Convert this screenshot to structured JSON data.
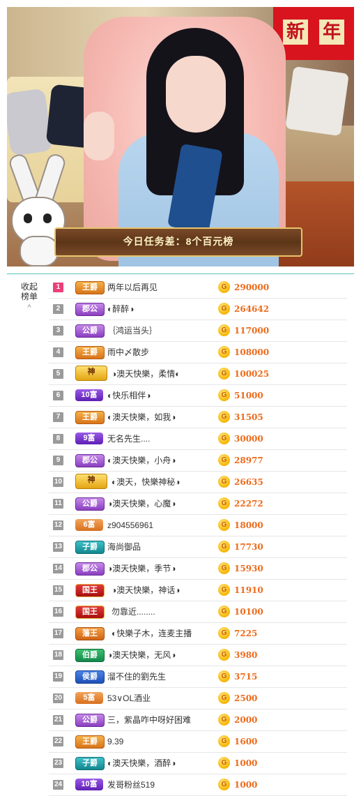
{
  "stream": {
    "banner_text": "今日任务差：8个百元榜",
    "decor_chars": [
      "新",
      "年"
    ]
  },
  "sidebar": {
    "collapse_label": "收起\n榜单",
    "collapse_line1": "收起",
    "collapse_line2": "榜单"
  },
  "leaderboard": [
    {
      "rank": "1",
      "badge": "王爵",
      "badge_type": "b-wang",
      "name": "两年以后再见",
      "score": "290000"
    },
    {
      "rank": "2",
      "badge": "郡公",
      "badge_type": "b-dugong",
      "name": "◐醉醉◑",
      "score": "264642"
    },
    {
      "rank": "3",
      "badge": "公爵",
      "badge_type": "b-gong",
      "name": "｛鸿运当头｝",
      "score": "117000"
    },
    {
      "rank": "4",
      "badge": "王爵",
      "badge_type": "b-wang",
      "name": "雨中〆散步",
      "score": "108000"
    },
    {
      "rank": "5",
      "badge": "神",
      "badge_type": "b-shen",
      "name": "◑澳天快樂，柔情◐",
      "score": "100025"
    },
    {
      "rank": "6",
      "badge": "10富",
      "badge_type": "b-fu",
      "name": "◐快乐相伴◑",
      "score": "51000"
    },
    {
      "rank": "7",
      "badge": "王爵",
      "badge_type": "b-wang",
      "name": "◐澳天快樂，如我◑",
      "score": "31505"
    },
    {
      "rank": "8",
      "badge": "9富",
      "badge_type": "b-fu",
      "name": "无名先生....",
      "score": "30000"
    },
    {
      "rank": "9",
      "badge": "郡公",
      "badge_type": "b-dugong",
      "name": "◐澳天快樂，小舟◑",
      "score": "28977"
    },
    {
      "rank": "10",
      "badge": "神",
      "badge_type": "b-shen",
      "name": "◐澳天，快樂神秘◑",
      "score": "26635"
    },
    {
      "rank": "11",
      "badge": "公爵",
      "badge_type": "b-gong",
      "name": "◑澳天快樂，心魔◑",
      "score": "22272"
    },
    {
      "rank": "12",
      "badge": "6富",
      "badge_type": "b-fu6",
      "name": "z904556961",
      "score": "18000"
    },
    {
      "rank": "13",
      "badge": "子爵",
      "badge_type": "b-zi",
      "name": "海尚御品",
      "score": "17730"
    },
    {
      "rank": "14",
      "badge": "郡公",
      "badge_type": "b-dugong",
      "name": "◑澳天快樂，季节◑",
      "score": "15930"
    },
    {
      "rank": "15",
      "badge": "国王",
      "badge_type": "b-guo",
      "name": "◑澳天快樂，神话◑",
      "score": "11910"
    },
    {
      "rank": "16",
      "badge": "国王",
      "badge_type": "b-guo",
      "name": "勿靠近........",
      "score": "10100"
    },
    {
      "rank": "17",
      "badge": "藩王",
      "badge_type": "b-fan",
      "name": "◐快樂子木，连麦主播",
      "score": "7225"
    },
    {
      "rank": "18",
      "badge": "伯爵",
      "badge_type": "b-bo",
      "name": "◑澳天快樂，无风◑",
      "score": "3980"
    },
    {
      "rank": "19",
      "badge": "侯爵",
      "badge_type": "b-hou",
      "name": "溜不住的劉先生",
      "score": "3715"
    },
    {
      "rank": "20",
      "badge": "5富",
      "badge_type": "b-fu5",
      "name": "53∨OL酒业",
      "score": "2500"
    },
    {
      "rank": "21",
      "badge": "公爵",
      "badge_type": "b-gong",
      "name": "三，紫晶咋中呀好困难",
      "score": "2000"
    },
    {
      "rank": "22",
      "badge": "王爵",
      "badge_type": "b-wang",
      "name": "9.39",
      "score": "1600"
    },
    {
      "rank": "23",
      "badge": "子爵",
      "badge_type": "b-zi",
      "name": "◐澳天快樂，酒醉◑",
      "score": "1000"
    },
    {
      "rank": "24",
      "badge": "10富",
      "badge_type": "b-fu",
      "name": "发哥粉丝519",
      "score": "1000"
    }
  ],
  "coin_glyph": "G"
}
